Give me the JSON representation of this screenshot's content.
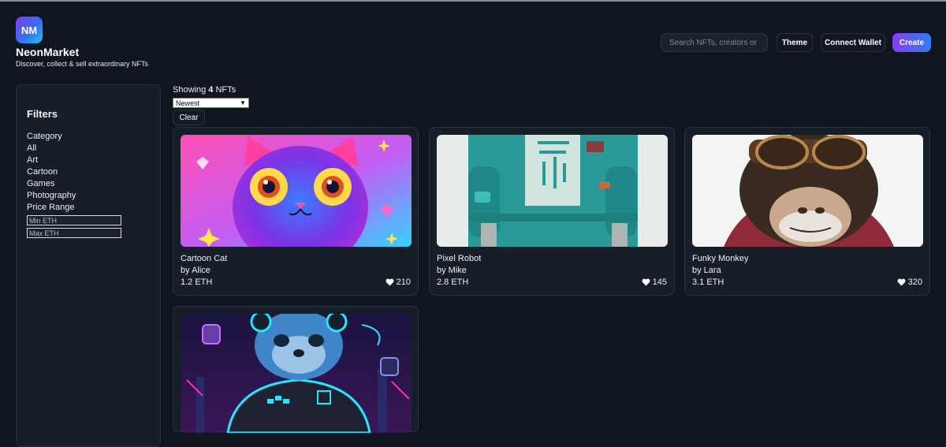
{
  "app": {
    "logo_text": "NM",
    "name": "NeonMarket",
    "tagline": "Discover, collect & sell extraordinary NFTs"
  },
  "header": {
    "search_placeholder": "Search NFTs, creators or co",
    "theme_label": "Theme",
    "wallet_label": "Connect Wallet",
    "create_label": "Create"
  },
  "filters": {
    "title": "Filters",
    "category_label": "Category",
    "categories": [
      "All",
      "Art",
      "Cartoon",
      "Games",
      "Photography"
    ],
    "price_label": "Price Range",
    "min_placeholder": "Min ETH",
    "max_placeholder": "Max ETH"
  },
  "results": {
    "showing_prefix": "Showing",
    "count": "4",
    "showing_suffix": "NFTs",
    "sort_selected": "Newest",
    "clear_label": "Clear"
  },
  "nfts": [
    {
      "name": "Cartoon Cat",
      "creator": "by Alice",
      "price": "1.2 ETH",
      "likes": "210"
    },
    {
      "name": "Pixel Robot",
      "creator": "by Mike",
      "price": "2.8 ETH",
      "likes": "145"
    },
    {
      "name": "Funky Monkey",
      "creator": "by Lara",
      "price": "3.1 ETH",
      "likes": "320"
    },
    {
      "name": "",
      "creator": "",
      "price": "",
      "likes": ""
    }
  ],
  "colors": {
    "background": "#0f1620",
    "panel": "#161e28",
    "accent_start": "#8b3cf2",
    "accent_end": "#2f7cf6"
  }
}
